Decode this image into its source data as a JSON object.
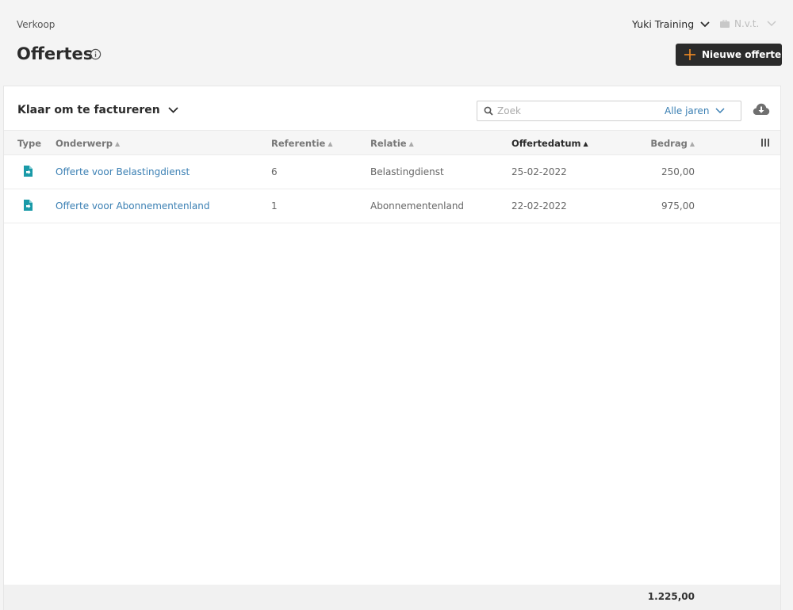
{
  "header": {
    "breadcrumb": "Verkoop",
    "title": "Offertes",
    "company": "Yuki Training",
    "administration": "N.v.t.",
    "new_button": "Nieuwe offerte"
  },
  "toolbar": {
    "filter": "Klaar om te factureren",
    "search_placeholder": "Zoek",
    "year_filter": "Alle jaren"
  },
  "table": {
    "columns": {
      "type": "Type",
      "subject": "Onderwerp",
      "reference": "Referentie",
      "relation": "Relatie",
      "date": "Offertedatum",
      "amount": "Bedrag"
    },
    "rows": [
      {
        "subject": "Offerte voor Belastingdienst",
        "reference": "6",
        "relation": "Belastingdienst",
        "date": "25-02-2022",
        "amount": "250,00"
      },
      {
        "subject": "Offerte voor Abonnementenland",
        "reference": "1",
        "relation": "Abonnementenland",
        "date": "22-02-2022",
        "amount": "975,00"
      }
    ],
    "total": "1.225,00"
  },
  "colors": {
    "accent_orange": "#f08a24",
    "link_blue": "#3a7fb3",
    "doc_teal": "#1a9aa8",
    "dark": "#2b2b2b"
  }
}
